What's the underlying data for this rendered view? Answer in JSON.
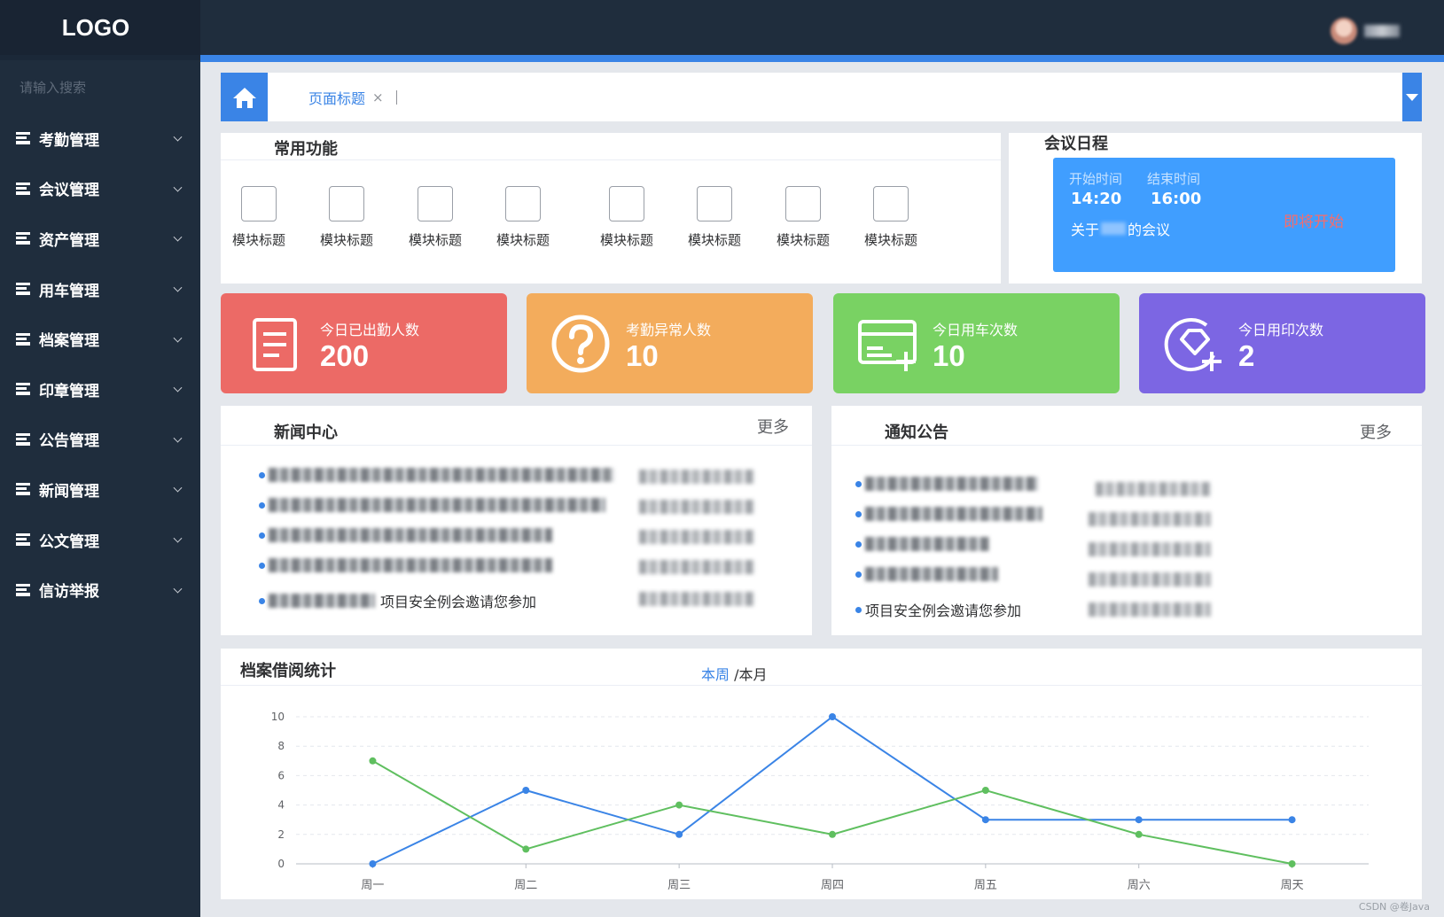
{
  "app": {
    "logo": "LOGO"
  },
  "sidebar": {
    "search_placeholder": "请输入搜索",
    "items": [
      {
        "label": "考勤管理"
      },
      {
        "label": "会议管理"
      },
      {
        "label": "资产管理"
      },
      {
        "label": "用车管理"
      },
      {
        "label": "档案管理"
      },
      {
        "label": "印章管理"
      },
      {
        "label": "公告管理"
      },
      {
        "label": "新闻管理"
      },
      {
        "label": "公文管理"
      },
      {
        "label": "信访举报"
      }
    ]
  },
  "tabs": {
    "home_icon": "home-icon",
    "active_tab": "页面标题",
    "close_glyph": "×",
    "dropdown_icon": "caret-down-icon"
  },
  "common": {
    "title": "常用功能",
    "modules": [
      "模块标题",
      "模块标题",
      "模块标题",
      "模块标题",
      "模块标题",
      "模块标题",
      "模块标题",
      "模块标题"
    ]
  },
  "meeting": {
    "title": "会议日程",
    "start_label": "开始时间",
    "end_label": "结束时间",
    "start_time": "14:20",
    "end_time": "16:00",
    "topic_prefix": "关于",
    "topic_suffix": "的会议",
    "status": "即将开始"
  },
  "stats": [
    {
      "label": "今日已出勤人数",
      "value": "200",
      "color": "#ec6a66",
      "icon": "document-icon"
    },
    {
      "label": "考勤异常人数",
      "value": "10",
      "color": "#f3ac5c",
      "icon": "question-circle-icon"
    },
    {
      "label": "今日用车次数",
      "value": "10",
      "color": "#79d263",
      "icon": "card-add-icon"
    },
    {
      "label": "今日用印次数",
      "value": "2",
      "color": "#7c66e3",
      "icon": "seal-add-icon"
    }
  ],
  "news": {
    "title": "新闻中心",
    "more": "更多",
    "last_item": "项目安全例会邀请您参加"
  },
  "notice": {
    "title": "通知公告",
    "more": "更多",
    "last_item": "项目安全例会邀请您参加"
  },
  "chart_section": {
    "title": "档案借阅统计",
    "toggle_week": "本周",
    "toggle_sep": "/",
    "toggle_month": "本月"
  },
  "chart_data": {
    "type": "line",
    "categories": [
      "周一",
      "周二",
      "周三",
      "周四",
      "周五",
      "周六",
      "周天"
    ],
    "series": [
      {
        "values": [
          0,
          5,
          2,
          10,
          3,
          3,
          3
        ],
        "color": "#3a84e6"
      },
      {
        "values": [
          7,
          1,
          4,
          2,
          5,
          2,
          0
        ],
        "color": "#5fbf5f"
      }
    ],
    "ylim": [
      0,
      10
    ],
    "yticks": [
      0,
      2,
      4,
      6,
      8,
      10
    ],
    "grid": true
  },
  "watermark": "CSDN @卷Java"
}
